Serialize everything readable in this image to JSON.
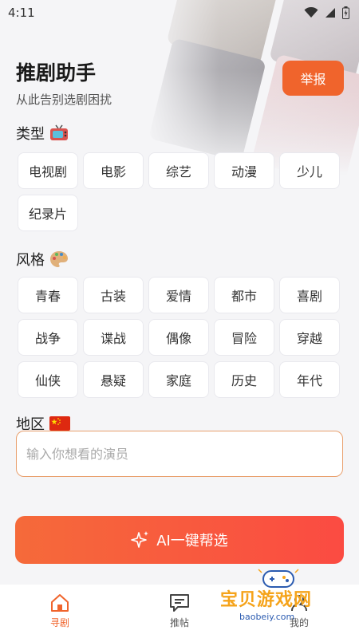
{
  "status_bar": {
    "time": "4:11"
  },
  "header": {
    "title": "推剧助手",
    "subtitle": "从此告别选剧困扰",
    "report_label": "举报"
  },
  "sections": {
    "type": {
      "title": "类型",
      "icon": "tv-icon",
      "items": [
        "电视剧",
        "电影",
        "综艺",
        "动漫",
        "少儿",
        "纪录片"
      ]
    },
    "style": {
      "title": "风格",
      "icon": "palette-icon",
      "items": [
        "青春",
        "古装",
        "爱情",
        "都市",
        "喜剧",
        "战争",
        "谍战",
        "偶像",
        "冒险",
        "穿越",
        "仙侠",
        "悬疑",
        "家庭",
        "历史",
        "年代"
      ]
    },
    "region": {
      "title": "地区",
      "icon": "china-flag-icon"
    }
  },
  "actor_input": {
    "placeholder": "输入你想看的演员"
  },
  "ai_button": {
    "label": "AI一键帮选"
  },
  "bottom_nav": [
    {
      "label": "寻剧",
      "icon": "home-icon",
      "active": true
    },
    {
      "label": "推帖",
      "icon": "chat-icon",
      "active": false
    },
    {
      "label": "我的",
      "icon": "user-icon",
      "active": false
    }
  ],
  "watermark": {
    "text": "宝贝游戏网",
    "url": "baobeiy.com"
  },
  "colors": {
    "accent": "#f0642c",
    "button_gradient_end": "#fb4b42"
  }
}
